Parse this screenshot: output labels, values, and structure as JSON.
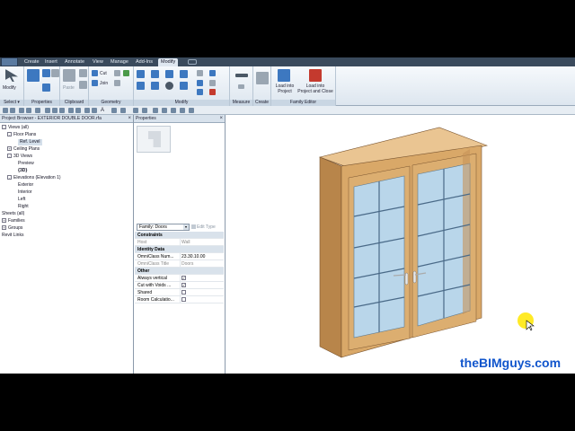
{
  "ribbon": {
    "tabs": [
      "Create",
      "Insert",
      "Annotate",
      "View",
      "Manage",
      "Add-Ins",
      "Modify"
    ],
    "active_tab": "Modify",
    "modify_label": "Modify",
    "cut_label": "Cut",
    "join_label": "Join",
    "paste_label": "Paste",
    "load_into_project": "Load into\nProject",
    "load_into_project_close": "Load into\nProject and Close",
    "panels": {
      "select": "Select ▾",
      "properties": "Properties",
      "clipboard": "Clipboard",
      "geometry": "Geometry",
      "modify": "Modify",
      "measure": "Measure",
      "create": "Create",
      "family_editor": "Family Editor"
    }
  },
  "project_browser": {
    "title": "Project Browser - EXTERIOR DOUBLE DOOR.rfa",
    "tree": [
      {
        "label": "Views (all)",
        "toggle": "-"
      },
      {
        "label": "Floor Plans",
        "toggle": "-"
      },
      {
        "label": "Ref. Level",
        "toggle": ""
      },
      {
        "label": "Ceiling Plans",
        "toggle": "+"
      },
      {
        "label": "3D Views",
        "toggle": "-"
      },
      {
        "label": "Preview",
        "toggle": ""
      },
      {
        "label": "{3D}",
        "toggle": ""
      },
      {
        "label": "Elevations (Elevation 1)",
        "toggle": "-"
      },
      {
        "label": "Exterior",
        "toggle": ""
      },
      {
        "label": "Interior",
        "toggle": ""
      },
      {
        "label": "Left",
        "toggle": ""
      },
      {
        "label": "Right",
        "toggle": ""
      },
      {
        "label": "Sheets (all)",
        "toggle": ""
      },
      {
        "label": "Families",
        "toggle": "+"
      },
      {
        "label": "Groups",
        "toggle": "+"
      },
      {
        "label": "Revit Links",
        "toggle": ""
      }
    ]
  },
  "properties": {
    "title": "Properties",
    "family_selector": "Family: Doors",
    "edit_type": "Edit Type",
    "rows": [
      {
        "k": "Constraints",
        "v": "",
        "group": true
      },
      {
        "k": "Host",
        "v": "Wall",
        "dim": true
      },
      {
        "k": "Identity Data",
        "v": "",
        "group": true
      },
      {
        "k": "OmniClass Num...",
        "v": "23.30.10.00"
      },
      {
        "k": "OmniClass Title",
        "v": "Doors",
        "dim": true
      },
      {
        "k": "Other",
        "v": "",
        "group": true
      },
      {
        "k": "Always vertical",
        "v": "✓",
        "check": true
      },
      {
        "k": "Cut with Voids ...",
        "v": "✓",
        "check": true
      },
      {
        "k": "Shared",
        "v": "",
        "check": true
      },
      {
        "k": "Room Calculatio...",
        "v": "",
        "check": true
      }
    ]
  },
  "watermark": "theBIMguys.com",
  "colors": {
    "door_frame": "#d9a868",
    "door_frame_dark": "#b8854a",
    "glass": "#b9d6ea",
    "muntin": "#4a6a88",
    "cursor_highlight": "#ffe600",
    "watermark": "#1155cc"
  }
}
